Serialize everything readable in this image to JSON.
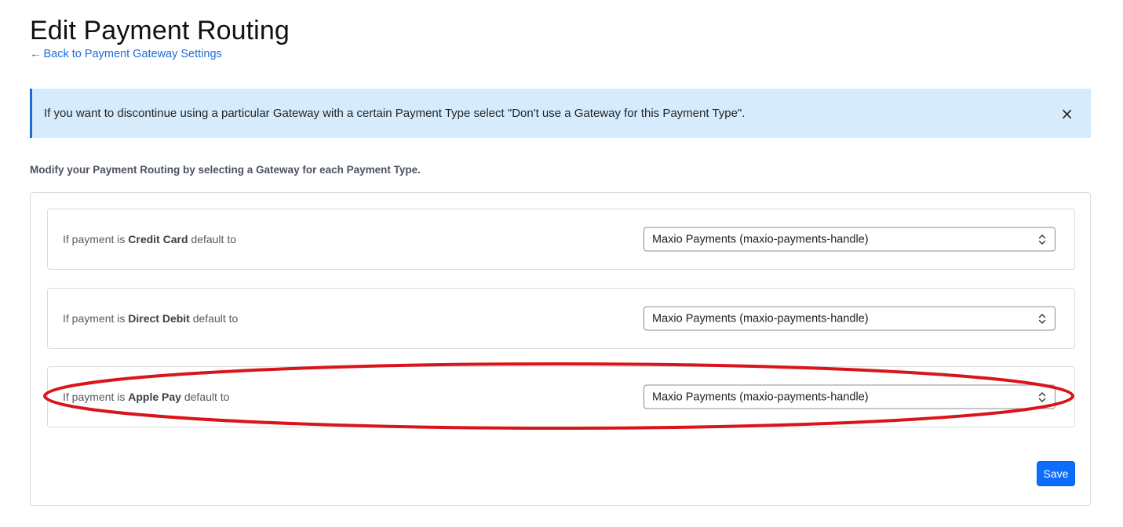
{
  "header": {
    "title": "Edit Payment Routing",
    "back_link_arrow": "←",
    "back_link_label": "Back to Payment Gateway Settings"
  },
  "alert": {
    "message": "If you want to discontinue using a particular Gateway with a certain Payment Type select \"Don't use a Gateway for this Payment Type\".",
    "close_glyph": "×"
  },
  "instructions": "Modify your Payment Routing by selecting a Gateway for each Payment Type.",
  "routes": [
    {
      "prefix": "If payment is",
      "payment_type": "Credit Card",
      "suffix": "default to",
      "selected_gateway": "Maxio Payments (maxio-payments-handle)"
    },
    {
      "prefix": "If payment is",
      "payment_type": "Direct Debit",
      "suffix": "default to",
      "selected_gateway": "Maxio Payments (maxio-payments-handle)"
    },
    {
      "prefix": "If payment is",
      "payment_type": "Apple Pay",
      "suffix": "default to",
      "selected_gateway": "Maxio Payments (maxio-payments-handle)"
    }
  ],
  "save_label": "Save",
  "colors": {
    "accent": "#1a6dd6",
    "alert_bg": "#d6ebfb",
    "button": "#0d6efd",
    "highlight": "#d9151b"
  }
}
